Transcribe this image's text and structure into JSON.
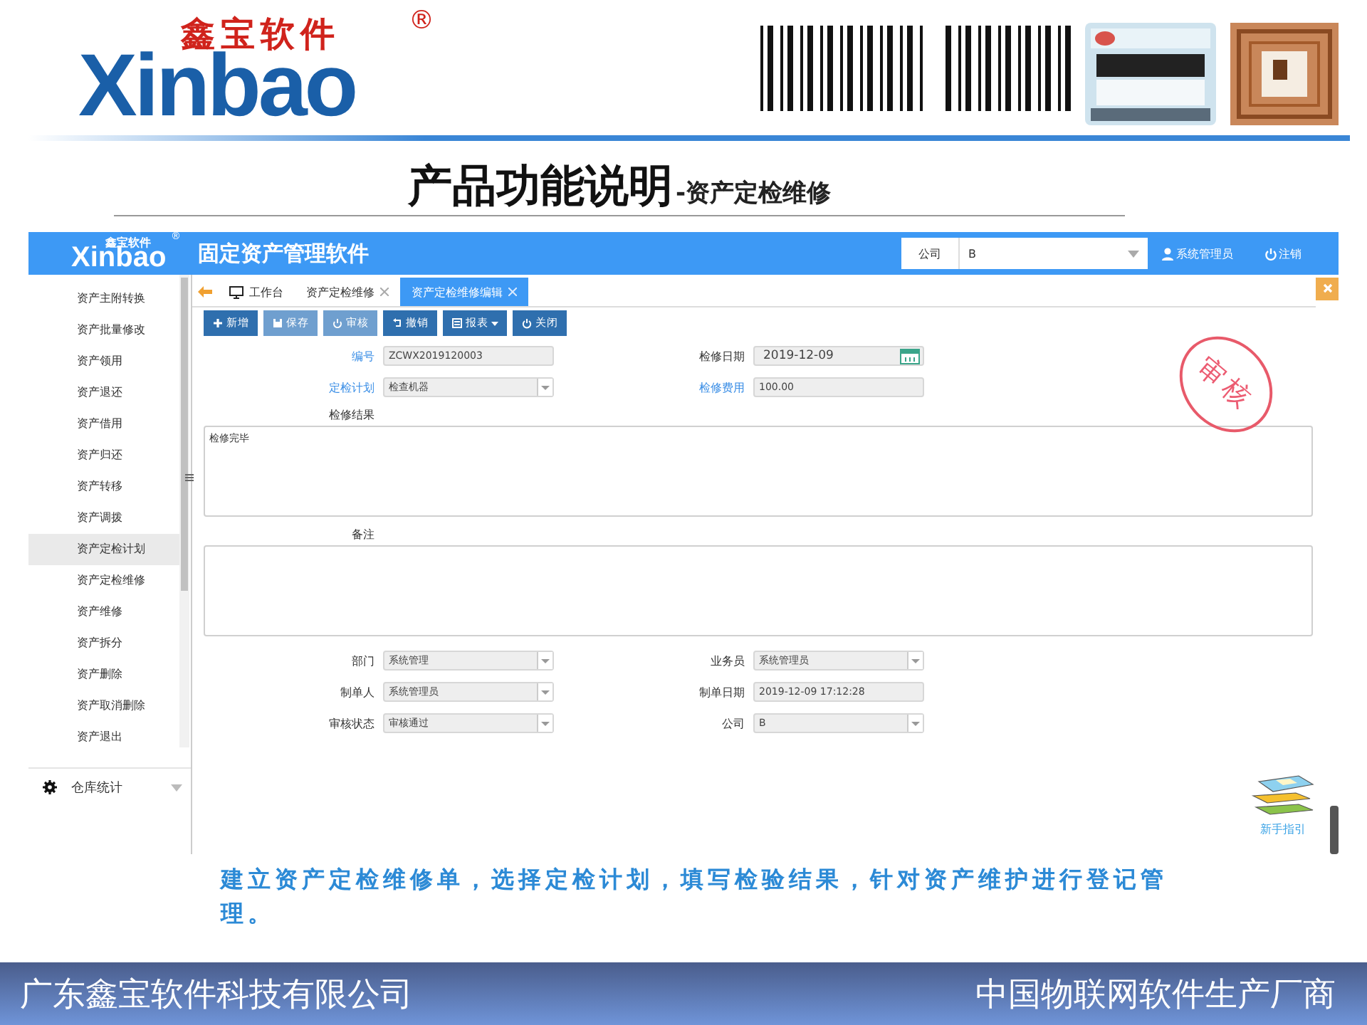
{
  "slide": {
    "logo_text": "Xinbao",
    "brand_name": "鑫宝软件",
    "brand_mark": "®",
    "title": "产品功能说明",
    "subtitle": "-资产定检维修"
  },
  "app": {
    "header": {
      "logo_text": "Xinbao",
      "brand_name": "鑫宝软件",
      "brand_mark": "®",
      "title": "固定资产管理软件",
      "company_label": "公司",
      "company_value": "B",
      "user": "系统管理员",
      "logout": "注销"
    },
    "sidebar": {
      "items": [
        {
          "label": "资产主附转换",
          "selected": false
        },
        {
          "label": "资产批量修改",
          "selected": false
        },
        {
          "label": "资产领用",
          "selected": false
        },
        {
          "label": "资产退还",
          "selected": false
        },
        {
          "label": "资产借用",
          "selected": false
        },
        {
          "label": "资产归还",
          "selected": false
        },
        {
          "label": "资产转移",
          "selected": false
        },
        {
          "label": "资产调拨",
          "selected": false
        },
        {
          "label": "资产定检计划",
          "selected": true
        },
        {
          "label": "资产定检维修",
          "selected": false
        },
        {
          "label": "资产维修",
          "selected": false
        },
        {
          "label": "资产拆分",
          "selected": false
        },
        {
          "label": "资产删除",
          "selected": false
        },
        {
          "label": "资产取消删除",
          "selected": false
        },
        {
          "label": "资产退出",
          "selected": false
        }
      ],
      "group": {
        "label": "仓库统计",
        "expanded": false
      }
    },
    "tabs": [
      {
        "label": "工作台",
        "kind": "home",
        "selected": false
      },
      {
        "label": "资产定检维修",
        "kind": "closable",
        "selected": false
      },
      {
        "label": "资产定检维修编辑",
        "kind": "closable",
        "selected": true
      }
    ],
    "toolbar": [
      {
        "label": "新增",
        "kind": "add",
        "disabled": false
      },
      {
        "label": "保存",
        "kind": "save",
        "disabled": true
      },
      {
        "label": "审核",
        "kind": "audit",
        "disabled": true
      },
      {
        "label": "撤销",
        "kind": "undo",
        "disabled": false
      },
      {
        "label": "报表",
        "kind": "report",
        "disabled": false
      },
      {
        "label": "关闭",
        "kind": "close",
        "disabled": false
      }
    ],
    "form": {
      "top_rows": [
        [
          {
            "label": "编号",
            "value": "ZCWX2019120003",
            "kind": "text",
            "required": true
          },
          {
            "label": "检修日期",
            "value": "2019-12-09",
            "kind": "date",
            "required": false
          }
        ],
        [
          {
            "label": "定检计划",
            "value": "检查机器",
            "kind": "select",
            "required": true
          },
          {
            "label": "检修费用",
            "value": "100.00",
            "kind": "text",
            "required": true
          }
        ]
      ],
      "areas": [
        {
          "label": "检修结果",
          "value": "检修完毕"
        },
        {
          "label": "备注"
        }
      ],
      "bottom_rows": [
        [
          {
            "label": "部门",
            "value": "系统管理",
            "kind": "select",
            "required": false
          },
          {
            "label": "业务员",
            "value": "系统管理员",
            "kind": "select",
            "required": false
          }
        ],
        [
          {
            "label": "制单人",
            "value": "系统管理员",
            "kind": "select",
            "required": false
          },
          {
            "label": "制单日期",
            "value": "2019-12-09 17:12:28",
            "kind": "text",
            "required": false
          }
        ],
        [
          {
            "label": "审核状态",
            "value": "审核通过",
            "kind": "select",
            "required": false
          },
          {
            "label": "公司",
            "value": "B",
            "kind": "select",
            "required": false
          }
        ]
      ]
    },
    "stamp": "审核",
    "help": "新手指引"
  },
  "caption": "建立资产定检维修单，选择定检计划，填写检验结果，针对资产维护进行登记管理。",
  "footer": {
    "left": "广东鑫宝软件科技有限公司",
    "right": "中国物联网软件生产厂商"
  }
}
